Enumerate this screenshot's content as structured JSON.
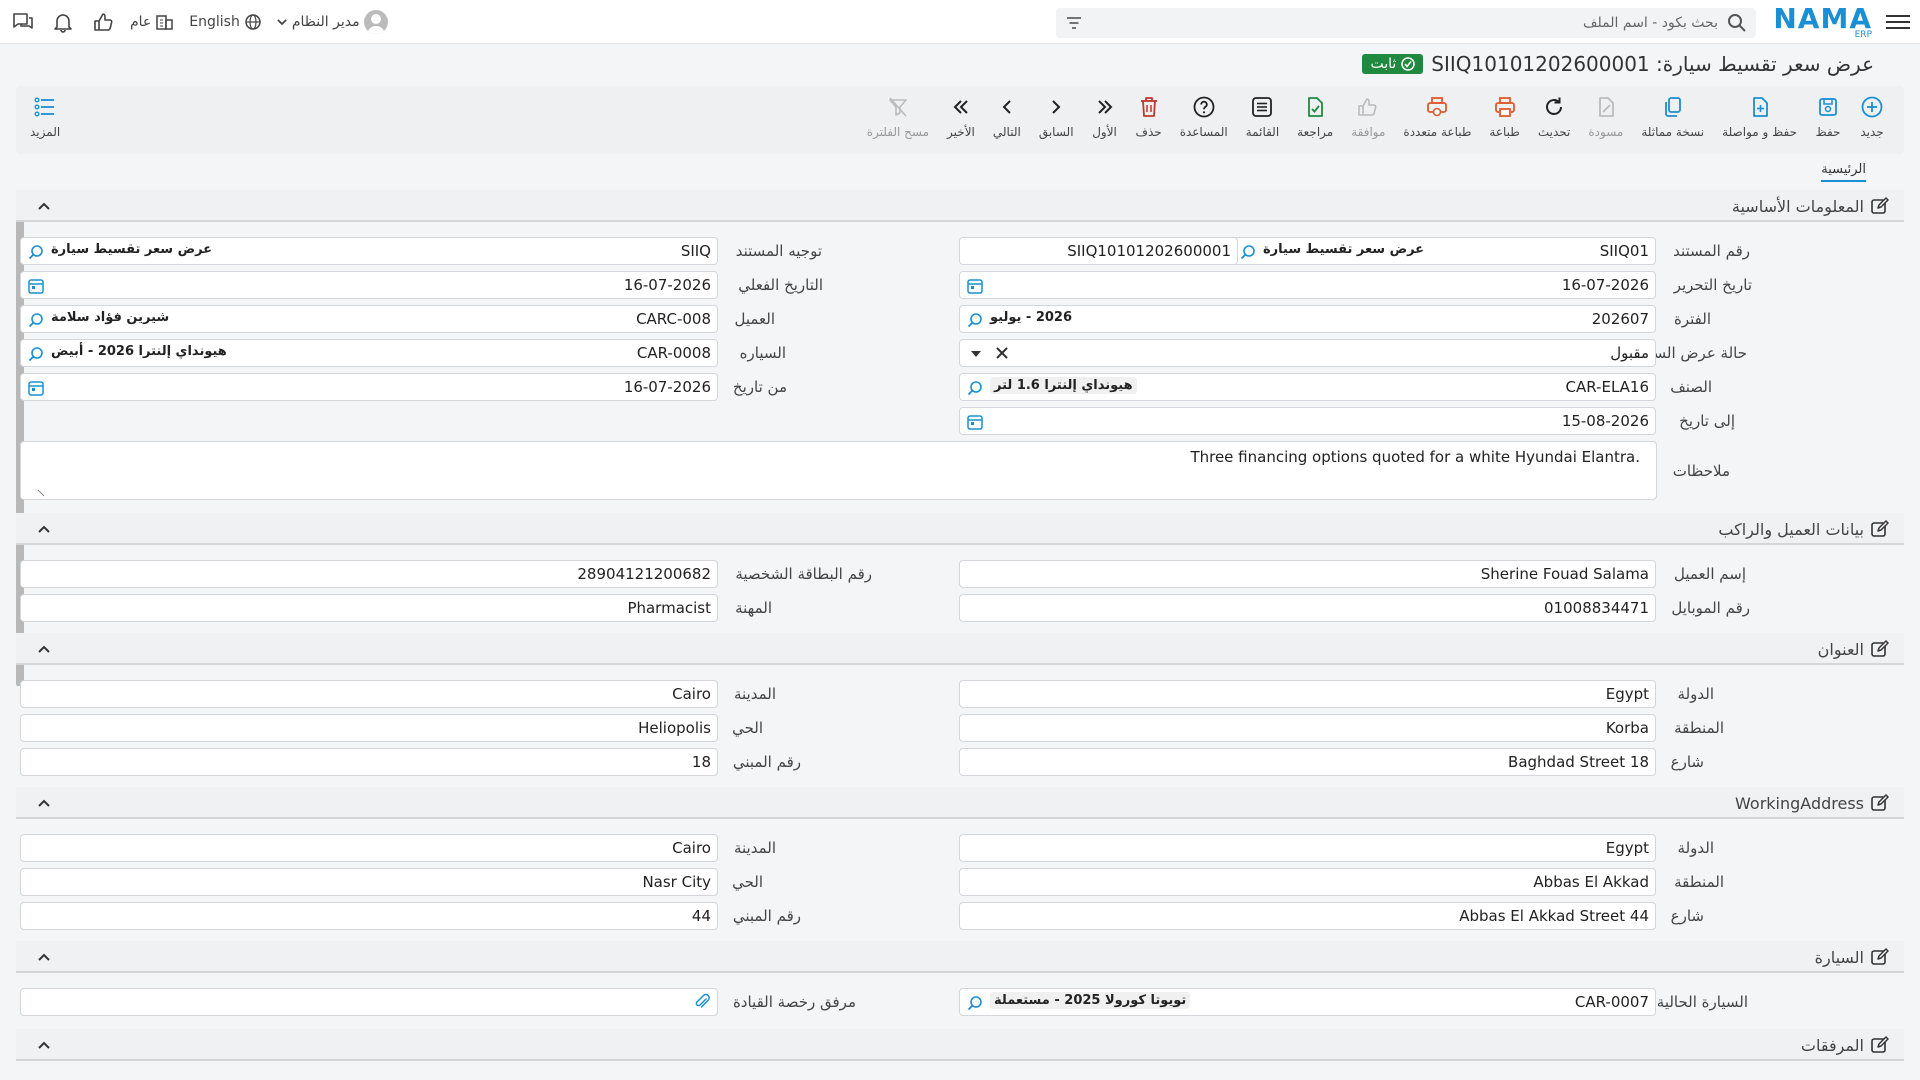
{
  "app": {
    "logo": "NAMA",
    "logo_sub": "ERP"
  },
  "topbar": {
    "search_placeholder": "بحث بكود - اسم الملف",
    "user": "مدير النظام",
    "language": "English",
    "scope": "عام"
  },
  "page": {
    "title": "عرض سعر تقسيط سيارة: SIIQ10101202600001",
    "status": "ثابت"
  },
  "toolbar": {
    "new": "جديد",
    "save": "حفظ",
    "save_continue": "حفظ و مواصلة",
    "duplicate": "نسخة مماثلة",
    "draft": "مسودة",
    "refresh": "تحديث",
    "print": "طباعة",
    "multi_print": "طباعة متعددة",
    "approve": "موافقة",
    "review": "مراجعة",
    "list": "القائمة",
    "help": "المساعدة",
    "delete": "حذف",
    "first": "الأول",
    "previous": "السابق",
    "next": "التالي",
    "last": "الأخير",
    "clear_filter": "مسح الفلترة",
    "more": "المزيد"
  },
  "tabs": {
    "main": "الرئيسية"
  },
  "basic": {
    "title": "المعلومات الأساسية",
    "doc_number_label": "رقم المستند",
    "doc_code": "SIIQ01",
    "doc_type_name": "عرض سعر تقسيط سيارة",
    "doc_number": "SIIQ10101202600001",
    "doc_direction_label": "توجيه المستند",
    "direction_code": "SIIQ",
    "direction_name": "عرض سعر تقسيط سيارة",
    "issue_date_label": "تاريخ التحرير",
    "issue_date": "16-07-2026",
    "actual_date_label": "التاريخ الفعلي",
    "actual_date": "16-07-2026",
    "period_label": "الفترة",
    "period_code": "202607",
    "period_name": "2026 - يوليو",
    "customer_label": "العميل",
    "customer_code": "CARC-008",
    "customer_name": "شيرين فؤاد سلامة",
    "quote_status_label": "حالة عرض السعر",
    "quote_status": "مقبول",
    "car_label": "السياره",
    "car_code": "CAR-0008",
    "car_name": "هيونداي إلنترا 2026 - أبيض",
    "item_label": "الصنف",
    "item_code": "CAR-ELA16",
    "item_name": "هيونداي إلنترا 1.6 لتر",
    "from_date_label": "من تاريخ",
    "from_date": "16-07-2026",
    "to_date_label": "إلى تاريخ",
    "to_date": "15-08-2026",
    "notes_label": "ملاحظات",
    "notes": "Three financing options quoted for a white Hyundai Elantra."
  },
  "customer": {
    "title": "بيانات العميل والراكب",
    "name_label": "إسم العميل",
    "name": "Sherine Fouad Salama",
    "id_label": "رقم البطاقة الشخصية",
    "id": "28904121200682",
    "mobile_label": "رقم الموبايل",
    "mobile": "01008834471",
    "job_label": "المهنة",
    "job": "Pharmacist"
  },
  "address": {
    "title": "العنوان",
    "country_label": "الدولة",
    "country": "Egypt",
    "city_label": "المدينة",
    "city": "Cairo",
    "region_label": "المنطقة",
    "region": "Korba",
    "district_label": "الحي",
    "district": "Heliopolis",
    "street_label": "شارع",
    "street": "Baghdad Street 18",
    "building_label": "رقم المبني",
    "building": "18"
  },
  "work_address": {
    "title": "WorkingAddress",
    "country_label": "الدولة",
    "country": "Egypt",
    "city_label": "المدينة",
    "city": "Cairo",
    "region_label": "المنطقة",
    "region": "Abbas El Akkad",
    "district_label": "الحي",
    "district": "Nasr City",
    "street_label": "شارع",
    "street": "Abbas El Akkad Street 44",
    "building_label": "رقم المبني",
    "building": "44"
  },
  "vehicle": {
    "title": "السيارة",
    "current_label": "السيارة الحالية",
    "current_code": "CAR-0007",
    "current_name": "تويوتا كورولا 2025 - مستعملة",
    "license_label": "مرفق رخصة القيادة"
  },
  "attachments": {
    "title": "المرفقات"
  },
  "colors": {
    "accent": "#1b8fd3",
    "status": "#1f8a3f",
    "delete": "#c0392b",
    "print": "#e05a2b"
  }
}
